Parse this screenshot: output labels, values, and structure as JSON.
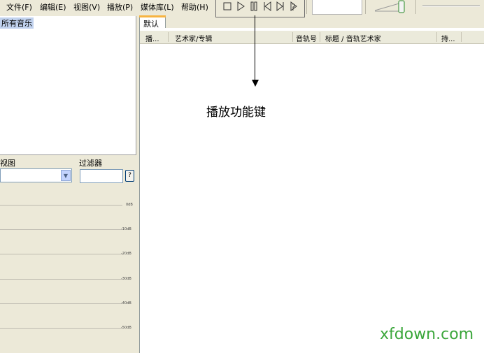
{
  "menubar": {
    "items": [
      "文件(F)",
      "编辑(E)",
      "视图(V)",
      "播放(P)",
      "媒体库(L)",
      "帮助(H)"
    ]
  },
  "transport": {
    "buttons": [
      "stop-icon",
      "play-icon",
      "pause-icon",
      "previous-icon",
      "next-icon",
      "random-icon"
    ]
  },
  "library": {
    "tree_item": "所有音乐",
    "view_label": "视图",
    "filter_label": "过滤器",
    "help_label": "?"
  },
  "equalizer": {
    "labels": [
      "0dB",
      "-10dB",
      "-20dB",
      "-30dB",
      "-40dB",
      "-50dB"
    ]
  },
  "playlist": {
    "tab": "默认",
    "columns": [
      "播...",
      "艺术家/专辑",
      "音轨号",
      "标题 / 音轨艺术家",
      "持..."
    ]
  },
  "annotation": {
    "text": "播放功能键"
  },
  "watermark": "xfdown.com"
}
